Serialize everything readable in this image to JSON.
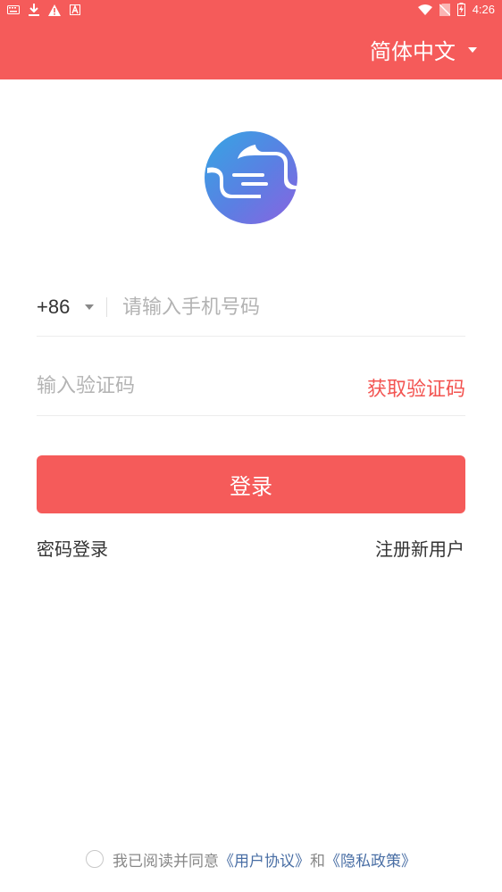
{
  "status_bar": {
    "time": "4:26",
    "left_icons": [
      "keyboard-icon",
      "download-icon",
      "warning-icon",
      "a-badge-icon"
    ],
    "right_icons": [
      "wifi-icon",
      "no-sim-icon",
      "battery-charging-icon"
    ]
  },
  "header": {
    "language": "简体中文",
    "background": "#f55b5a"
  },
  "form": {
    "country_code": "+86",
    "phone_placeholder": "请输入手机号码",
    "code_placeholder": "输入验证码",
    "get_code": "获取验证码",
    "login": "登录"
  },
  "links": {
    "password_login": "密码登录",
    "register": "注册新用户"
  },
  "agreement": {
    "prefix": "我已阅读并同意",
    "user_agreement": "《用户协议》",
    "and": "和",
    "privacy_policy": "《隐私政策》"
  },
  "colors": {
    "accent": "#f55b5a",
    "link": "#4a6fa5"
  }
}
